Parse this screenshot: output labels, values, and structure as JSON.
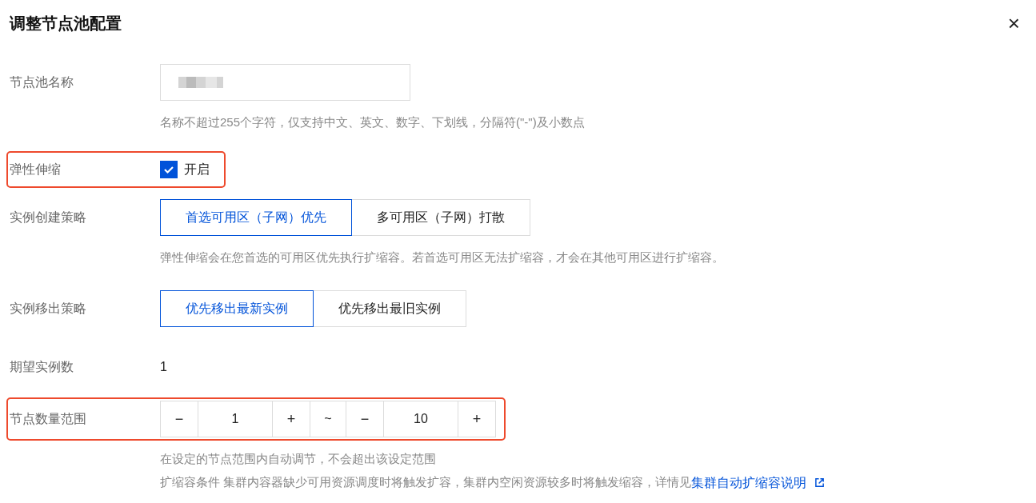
{
  "dialog": {
    "title": "调整节点池配置",
    "close": "×"
  },
  "name_row": {
    "label": "节点池名称",
    "hint": "名称不超过255个字符，仅支持中文、英文、数字、下划线，分隔符(\"-\")及小数点"
  },
  "autoscale_row": {
    "label": "弹性伸缩",
    "highlighted": true,
    "checkbox": {
      "label": "开启",
      "checked": true
    }
  },
  "create_policy": {
    "label": "实例创建策略",
    "options": [
      {
        "label": "首选可用区（子网）优先",
        "selected": true
      },
      {
        "label": "多可用区（子网）打散",
        "selected": false
      }
    ],
    "hint": "弹性伸缩会在您首选的可用区优先执行扩缩容。若首选可用区无法扩缩容，才会在其他可用区进行扩缩容。"
  },
  "remove_policy": {
    "label": "实例移出策略",
    "options": [
      {
        "label": "优先移出最新实例",
        "selected": true
      },
      {
        "label": "优先移出最旧实例",
        "selected": false
      }
    ]
  },
  "desired": {
    "label": "期望实例数",
    "value": "1"
  },
  "range_row": {
    "label": "节点数量范围",
    "highlighted": true,
    "min": {
      "minus": "−",
      "value": "1",
      "plus": "+"
    },
    "separator": "~",
    "max": {
      "minus": "−",
      "value": "10",
      "plus": "+"
    },
    "hint": "在设定的节点范围内自动调节，不会超出该设定范围",
    "condition_text": "扩缩容条件 集群内容器缺少可用资源调度时将触发扩容，集群内空闲资源较多时将触发缩容，详情见",
    "link": "集群自动扩缩容说明"
  }
}
